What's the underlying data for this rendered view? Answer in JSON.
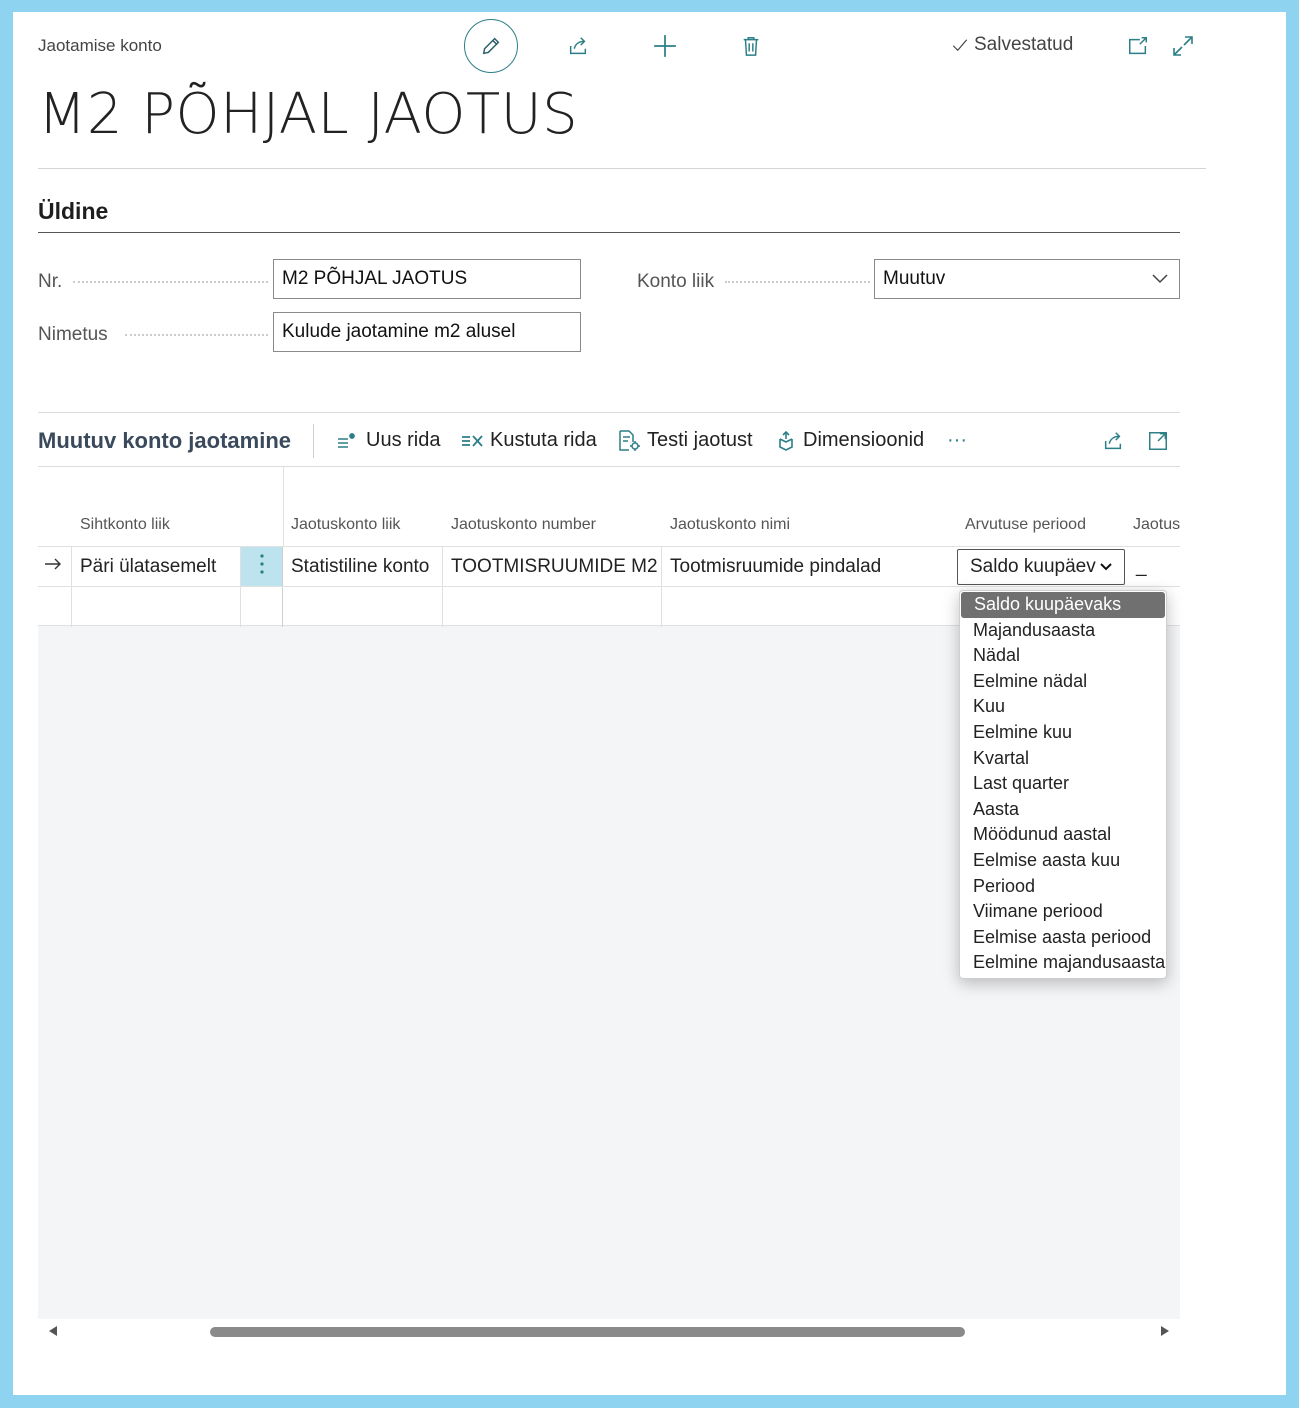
{
  "header": {
    "caption": "Jaotamise konto",
    "title": "M2 PÕHJAL JAOTUS",
    "saved_label": "Salvestatud"
  },
  "general": {
    "section_title": "Üldine",
    "nr_label": "Nr.",
    "nr_value": "M2 PÕHJAL JAOTUS",
    "name_label": "Nimetus",
    "name_value": "Kulude jaotamine m2 alusel",
    "account_type_label": "Konto liik",
    "account_type_value": "Muutuv"
  },
  "lines_part": {
    "title": "Muutuv konto jaotamine",
    "actions": {
      "new_line": "Uus rida",
      "delete_line": "Kustuta rida",
      "test": "Testi jaotust",
      "dimensions": "Dimensioonid",
      "more": "···"
    },
    "columns": [
      "Sihtkonto liik",
      "Jaotuskonto liik",
      "Jaotuskonto number",
      "Jaotuskonto nimi",
      "Arvutuse periood",
      "Jaotus"
    ],
    "row1": {
      "target_type": "Päri ülatasemelt",
      "alloc_type": "Statistiline konto",
      "alloc_number": "TOOTMISRUUMIDE M2",
      "alloc_name": "Tootmisruumide pindalad",
      "period": "Saldo kuupäev",
      "share": "_"
    }
  },
  "period_dropdown": {
    "selected": "Saldo kuupäevaks",
    "options": [
      "Saldo kuupäevaks",
      "Majandusaasta",
      "Nädal",
      "Eelmine nädal",
      "Kuu",
      "Eelmine kuu",
      "Kvartal",
      "Last quarter",
      "Aasta",
      "Möödunud aastal",
      "Eelmise aasta kuu",
      "Periood",
      "Viimane periood",
      "Eelmise aasta periood",
      "Eelmine majandusaasta"
    ]
  },
  "colors": {
    "accent": "#2b7f86",
    "frame": "#8ed3ef",
    "selected_cell": "#bde3ee"
  }
}
